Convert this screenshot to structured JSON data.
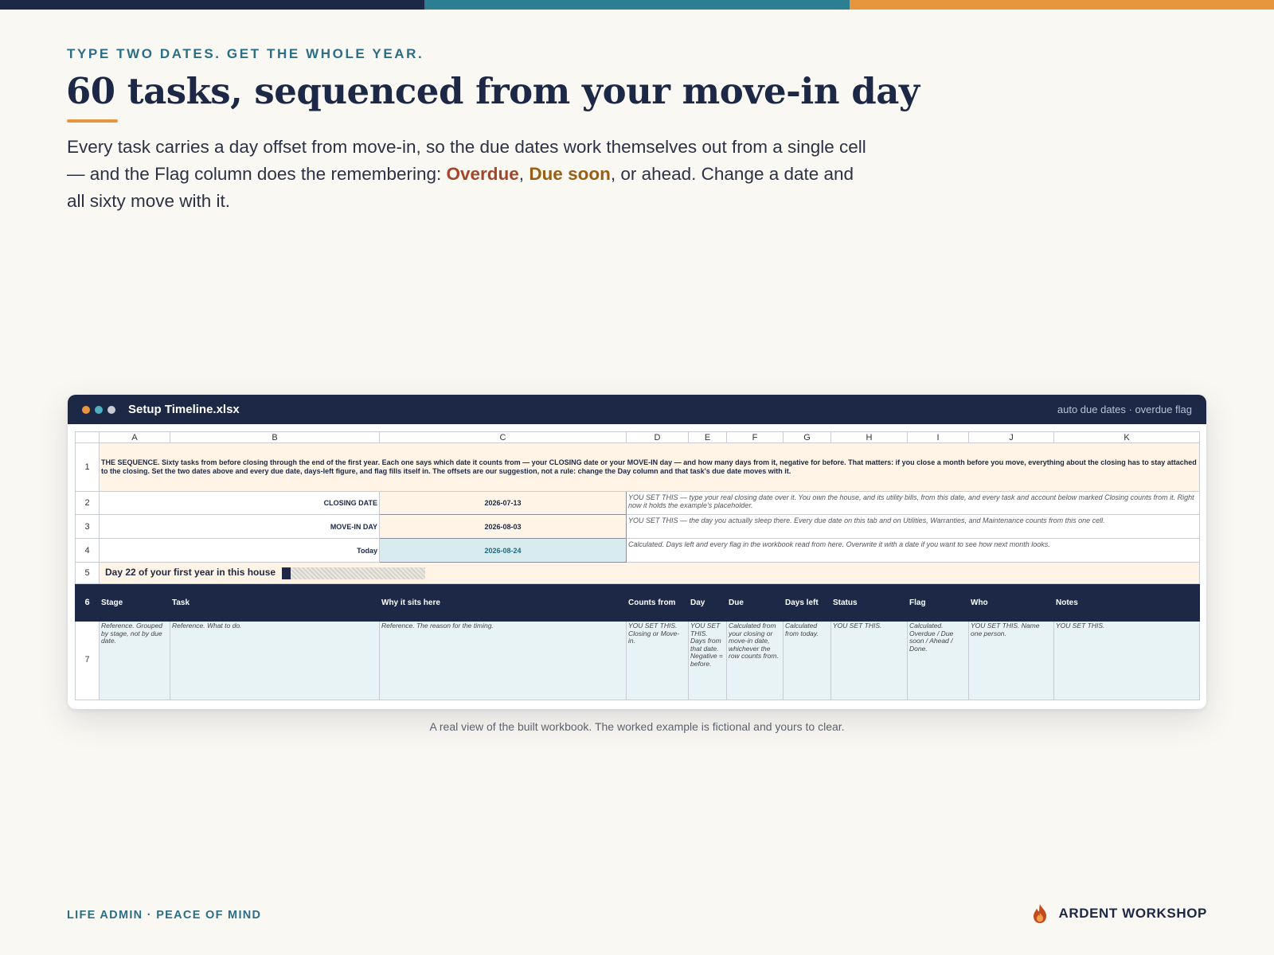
{
  "colors": {
    "navy": "#1c2846",
    "teal": "#2c7e93",
    "orange": "#e8963e"
  },
  "eyebrow": "TYPE TWO DATES. GET THE WHOLE YEAR.",
  "headline": "60 tasks, sequenced from your move-in day",
  "lede": {
    "part1": "Every task carries a day offset from move-in, so the due dates work themselves out from a single cell — and the Flag column does the remembering: ",
    "overdue": "Overdue",
    "comma": ", ",
    "due_soon": "Due soon",
    "part2": ", or ahead. Change a date and all sixty move with it."
  },
  "window": {
    "title": "Setup Timeline.xlsx",
    "tag": "auto due dates · overdue flag",
    "dot_colors": [
      "#e8963e",
      "#4fb0c2",
      "#c9ccd3"
    ]
  },
  "sheet": {
    "columns": [
      "A",
      "B",
      "C",
      "D",
      "E",
      "F",
      "G",
      "H",
      "I",
      "J",
      "K"
    ],
    "rows": [
      "1",
      "2",
      "3",
      "4",
      "5",
      "6",
      "7"
    ],
    "intro": "THE SEQUENCE. Sixty tasks from before closing through the end of the first year. Each one says which date it counts from — your CLOSING date or your MOVE-IN day — and how many days from it, negative for before. That matters: if you close a month before you move, everything about the closing has to stay attached to the closing. Set the two dates above and every due date, days-left figure, and flag fills itself in. The offsets are our suggestion, not a rule: change the Day column and that task's due date moves with it.",
    "closing_label": "CLOSING DATE",
    "closing_value": "2026-07-13",
    "closing_note": "YOU SET THIS — type your real closing date over it. You own the house, and its utility bills, from this date, and every task and account below marked Closing counts from it. Right now it holds the example's placeholder.",
    "movein_label": "MOVE-IN DAY",
    "movein_value": "2026-08-03",
    "movein_note": "YOU SET THIS — the day you actually sleep there. Every due date on this tab and on Utilities, Warranties, and Maintenance counts from this one cell.",
    "today_label": "Today",
    "today_value": "2026-08-24",
    "today_note": "Calculated. Days left and every flag in the workbook read from here. Overwrite it with a date if you want to see how next month looks.",
    "progress_text": "Day 22 of your first year in this house",
    "progress_fraction": 0.06,
    "headers": [
      "Stage",
      "Task",
      "Why it sits here",
      "Counts from",
      "Day",
      "Due",
      "Days left",
      "Status",
      "Flag",
      "Who",
      "Notes"
    ],
    "reference": [
      "Reference. Grouped by stage, not by due date.",
      "Reference. What to do.",
      "Reference. The reason for the timing.",
      "YOU SET THIS. Closing or Move-in.",
      "YOU SET THIS. Days from that date. Negative = before.",
      "Calculated from your closing or move-in date, whichever the row counts from.",
      "Calculated from today.",
      "YOU SET THIS.",
      "Calculated. Overdue / Due soon / Ahead / Done.",
      "YOU SET THIS. Name one person.",
      "YOU SET THIS."
    ]
  },
  "caption": "A real view of the built workbook. The worked example is fictional and yours to clear.",
  "footer": {
    "left": "LIFE ADMIN · PEACE OF MIND",
    "brand": "ARDENT WORKSHOP",
    "brand_icon": "flame-icon"
  }
}
